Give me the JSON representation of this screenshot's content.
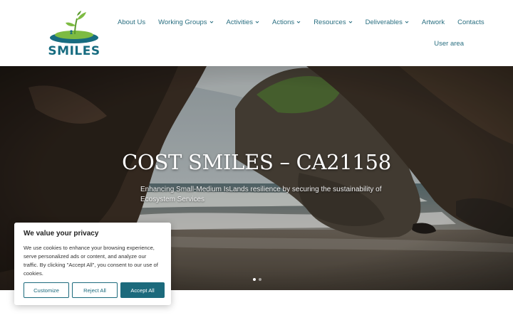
{
  "brand": {
    "name": "SMILES",
    "color": "#176c80",
    "accent_green": "#7dbb42"
  },
  "nav": {
    "items": [
      {
        "label": "About Us",
        "dropdown": false,
        "name": "nav-about-us"
      },
      {
        "label": "Working Groups",
        "dropdown": true,
        "name": "nav-working-groups"
      },
      {
        "label": "Activities",
        "dropdown": true,
        "name": "nav-activities"
      },
      {
        "label": "Actions",
        "dropdown": true,
        "name": "nav-actions"
      },
      {
        "label": "Resources",
        "dropdown": true,
        "name": "nav-resources"
      },
      {
        "label": "Deliverables",
        "dropdown": true,
        "name": "nav-deliverables"
      },
      {
        "label": "Artwork",
        "dropdown": false,
        "name": "nav-artwork"
      },
      {
        "label": "Contacts",
        "dropdown": false,
        "name": "nav-contacts"
      }
    ],
    "user_area": "User area",
    "link_color": "#2a6f81"
  },
  "hero": {
    "title": "COST SMILES – CA21158",
    "subtitle": "Enhancing Small-Medium IsLands resilience by securing the sustainability of Ecosystem Services",
    "slides": 2,
    "active_slide": 1
  },
  "cookie_banner": {
    "title": "We value your privacy",
    "text": "We use cookies to enhance your browsing experience, serve personalized ads or content, and analyze our traffic. By clicking \"Accept All\", you consent to our use of cookies.",
    "customize_label": "Customize",
    "reject_label": "Reject All",
    "accept_label": "Accept All",
    "button_color": "#1c6a7c"
  }
}
